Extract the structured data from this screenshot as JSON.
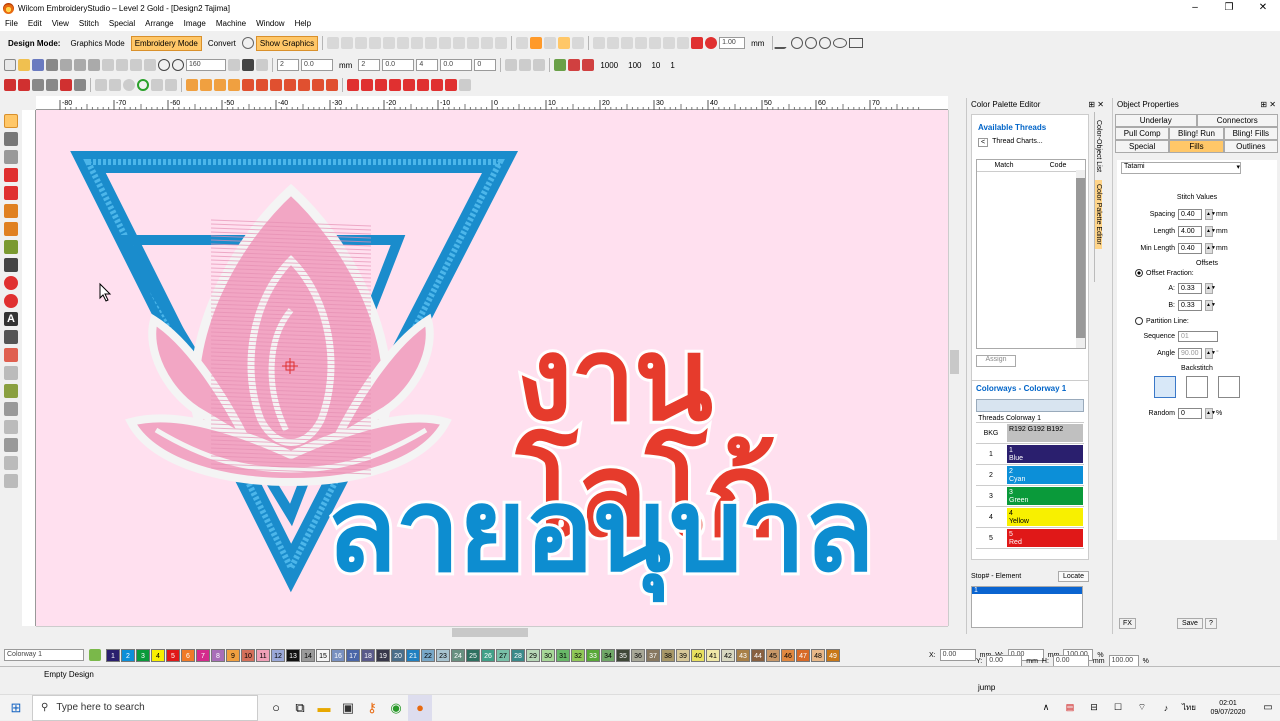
{
  "window": {
    "title": "Wilcom EmbroideryStudio – Level 2 Gold - [Design2        Tajima]",
    "min": "–",
    "max": "❐",
    "close": "✕"
  },
  "menu": [
    "File",
    "Edit",
    "View",
    "Stitch",
    "Special",
    "Arrange",
    "Image",
    "Machine",
    "Window",
    "Help"
  ],
  "toolbar1": {
    "design_mode_label": "Design Mode:",
    "graphics_mode": "Graphics Mode",
    "embroidery_mode": "Embroidery Mode",
    "convert": "Convert",
    "show_graphics": "Show Graphics",
    "zoom_value": "1.00",
    "unit": "mm"
  },
  "toolbar2": {
    "zoom": "160",
    "f1": "2",
    "f2": "0.0",
    "f3": "2",
    "f4": "0.0",
    "f5": "4",
    "f6": "0.0",
    "f7": "0",
    "mm": "mm",
    "n1000": "1000",
    "n100": "100",
    "n10": "10",
    "n1": "1"
  },
  "ruler": [
    "-80",
    "-70",
    "-60",
    "-50",
    "-40",
    "-30",
    "-20",
    "-10",
    "0",
    "10",
    "20",
    "30",
    "40",
    "50",
    "60",
    "70"
  ],
  "canvas": {
    "line1": "งานโลโก้",
    "line2": "ลายอนุบาล"
  },
  "color_palette_editor": {
    "title": "Color Palette Editor",
    "available_threads": "Available Threads",
    "thread_charts": "Thread Charts...",
    "col_match": "Match",
    "col_code": "Code",
    "assign": "Assign",
    "colorways_title": "Colorways - Colorway 1",
    "col_threads": "Threads",
    "col_colorway": "Colorway 1",
    "bkg_label": "BKG",
    "bkg_value": "R192 G192 B192",
    "rows": [
      {
        "num": "1",
        "idx": "1",
        "name": "Blue",
        "color": "#2a1f6e"
      },
      {
        "num": "2",
        "idx": "2",
        "name": "Cyan",
        "color": "#0c8fd8"
      },
      {
        "num": "3",
        "idx": "3",
        "name": "Green",
        "color": "#0a9a3a"
      },
      {
        "num": "4",
        "idx": "4",
        "name": "Yellow",
        "color": "#f8f000"
      },
      {
        "num": "5",
        "idx": "5",
        "name": "Red",
        "color": "#e01818"
      }
    ],
    "stop_element": "Stop# - Element",
    "locate": "Locate",
    "stop_value": "1",
    "side_tabs": [
      "Color-Object List",
      "Color Palette Editor"
    ]
  },
  "object_properties": {
    "title": "Object Properties",
    "tabs_row1": [
      "Underlay",
      "Connectors"
    ],
    "tabs_row2": [
      "Pull Comp",
      "Bling! Run",
      "Bling! Fills"
    ],
    "tabs_row3": [
      "Special",
      "Fills",
      "Outlines"
    ],
    "fill_type": "Tatami",
    "stitch_values": "Stitch Values",
    "spacing_label": "Spacing",
    "spacing": "0.40",
    "length_label": "Length",
    "length": "4.00",
    "min_length_label": "Min Length",
    "min_length": "0.40",
    "mm": "mm",
    "offsets": "Offsets",
    "offset_fraction": "Offset Fraction:",
    "a_label": "A:",
    "a": "0.33",
    "b_label": "B:",
    "b": "0.33",
    "partition_line": "Partition Line:",
    "sequence_label": "Sequence",
    "sequence": "01",
    "angle_label": "Angle",
    "angle": "90.00",
    "deg": "°",
    "backstitch": "Backstitch",
    "random_label": "Random",
    "random": "0",
    "pct": "%",
    "fx": "FX",
    "save": "Save",
    "help": "?"
  },
  "palette_bar": {
    "colorway": "Colorway 1",
    "swatches": [
      {
        "n": "1",
        "c": "#2a1f6e",
        "t": "#fff"
      },
      {
        "n": "2",
        "c": "#0c8fd8",
        "t": "#fff"
      },
      {
        "n": "3",
        "c": "#0a9a3a",
        "t": "#fff"
      },
      {
        "n": "4",
        "c": "#f8f000",
        "t": "#000"
      },
      {
        "n": "5",
        "c": "#e01818",
        "t": "#fff"
      },
      {
        "n": "6",
        "c": "#f07a28",
        "t": "#fff"
      },
      {
        "n": "7",
        "c": "#d42a8c",
        "t": "#fff"
      },
      {
        "n": "8",
        "c": "#a86eb8",
        "t": "#fff"
      },
      {
        "n": "9",
        "c": "#f0a040",
        "t": "#000"
      },
      {
        "n": "10",
        "c": "#d4705a",
        "t": "#000"
      },
      {
        "n": "11",
        "c": "#f0a0b8",
        "t": "#000"
      },
      {
        "n": "12",
        "c": "#9aa8d8",
        "t": "#000"
      },
      {
        "n": "13",
        "c": "#111111",
        "t": "#fff"
      },
      {
        "n": "14",
        "c": "#9a9a9a",
        "t": "#000"
      },
      {
        "n": "15",
        "c": "#f4f4f4",
        "t": "#000"
      },
      {
        "n": "16",
        "c": "#7890c0",
        "t": "#fff"
      },
      {
        "n": "17",
        "c": "#4a66a8",
        "t": "#fff"
      },
      {
        "n": "18",
        "c": "#5a5a8a",
        "t": "#fff"
      },
      {
        "n": "19",
        "c": "#38384a",
        "t": "#fff"
      },
      {
        "n": "20",
        "c": "#4a6e8a",
        "t": "#fff"
      },
      {
        "n": "21",
        "c": "#2080c0",
        "t": "#fff"
      },
      {
        "n": "22",
        "c": "#78a8c8",
        "t": "#000"
      },
      {
        "n": "23",
        "c": "#a8c4d0",
        "t": "#000"
      },
      {
        "n": "24",
        "c": "#689080",
        "t": "#fff"
      },
      {
        "n": "25",
        "c": "#2e7060",
        "t": "#fff"
      },
      {
        "n": "26",
        "c": "#40a088",
        "t": "#fff"
      },
      {
        "n": "27",
        "c": "#78c0a8",
        "t": "#000"
      },
      {
        "n": "28",
        "c": "#3a8a8a",
        "t": "#fff"
      },
      {
        "n": "29",
        "c": "#b8d8b8",
        "t": "#000"
      },
      {
        "n": "30",
        "c": "#a8d898",
        "t": "#000"
      },
      {
        "n": "31",
        "c": "#68b868",
        "t": "#000"
      },
      {
        "n": "32",
        "c": "#90c858",
        "t": "#000"
      },
      {
        "n": "33",
        "c": "#58a838",
        "t": "#fff"
      },
      {
        "n": "34",
        "c": "#70a868",
        "t": "#000"
      },
      {
        "n": "35",
        "c": "#404838",
        "t": "#fff"
      },
      {
        "n": "36",
        "c": "#a8a898",
        "t": "#000"
      },
      {
        "n": "37",
        "c": "#887860",
        "t": "#fff"
      },
      {
        "n": "38",
        "c": "#a89868",
        "t": "#000"
      },
      {
        "n": "39",
        "c": "#d8c898",
        "t": "#000"
      },
      {
        "n": "40",
        "c": "#e8e060",
        "t": "#000"
      },
      {
        "n": "41",
        "c": "#f0e8a8",
        "t": "#000"
      },
      {
        "n": "42",
        "c": "#d8d8c0",
        "t": "#000"
      },
      {
        "n": "43",
        "c": "#a88048",
        "t": "#fff"
      },
      {
        "n": "44",
        "c": "#886040",
        "t": "#fff"
      },
      {
        "n": "45",
        "c": "#c89868",
        "t": "#000"
      },
      {
        "n": "46",
        "c": "#e08840",
        "t": "#000"
      },
      {
        "n": "47",
        "c": "#d86a28",
        "t": "#fff"
      },
      {
        "n": "48",
        "c": "#e8b888",
        "t": "#000"
      },
      {
        "n": "49",
        "c": "#c87818",
        "t": "#fff"
      }
    ],
    "coords": {
      "x_label": "X:",
      "x": "0.00",
      "y_label": "Y:",
      "y": "0.00",
      "w_label": "W:",
      "w": "0.00",
      "h_label": "H:",
      "h": "0.00",
      "mm": "mm",
      "pw": "100.00",
      "ph": "100.00",
      "pct": "%"
    }
  },
  "status": {
    "left": "Empty Design",
    "right": "jump"
  },
  "taskbar": {
    "search_placeholder": "Type here to search",
    "time": "02:01",
    "date": "09/07/2020",
    "lang": "ไทย"
  }
}
